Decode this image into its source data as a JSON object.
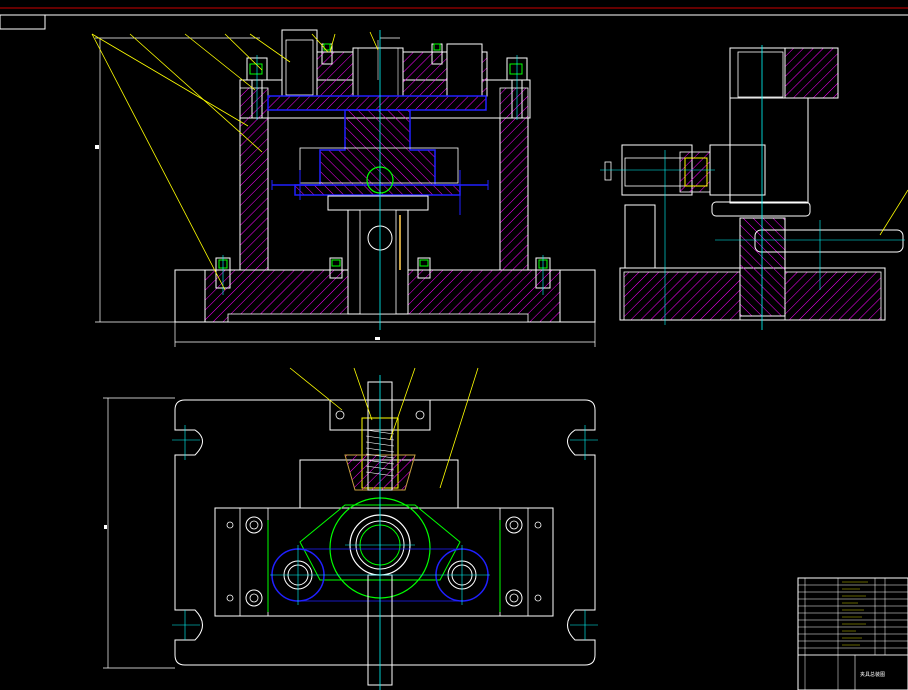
{
  "colors": {
    "background": "#000000",
    "outline": "#ffffff",
    "hatch": "#ff00ff",
    "blue": "#2020ff",
    "cyan": "#00ffff",
    "green": "#00ff00",
    "yellow": "#ffff00",
    "red": "#cc0000",
    "orange": "#c8a040"
  },
  "views": [
    "front-section",
    "side-section",
    "top-plan"
  ],
  "title_block": {
    "drawing_title": "夹具总装图"
  }
}
